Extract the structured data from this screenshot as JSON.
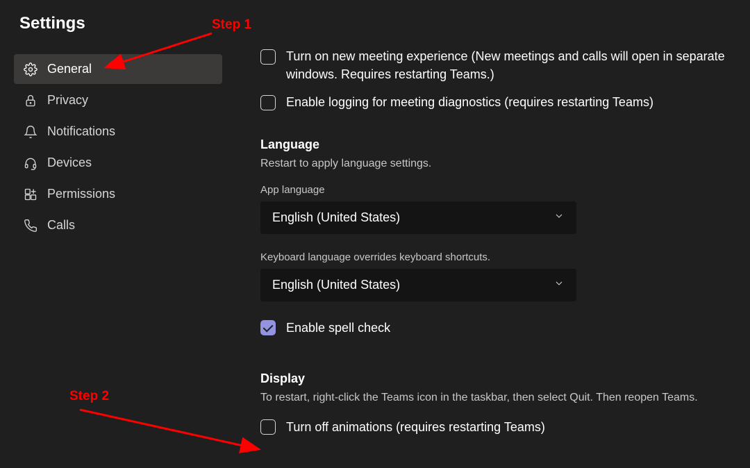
{
  "page_title": "Settings",
  "sidebar": {
    "items": [
      {
        "label": "General",
        "active": true
      },
      {
        "label": "Privacy",
        "active": false
      },
      {
        "label": "Notifications",
        "active": false
      },
      {
        "label": "Devices",
        "active": false
      },
      {
        "label": "Permissions",
        "active": false
      },
      {
        "label": "Calls",
        "active": false
      }
    ]
  },
  "checkboxes": {
    "new_meeting_experience": {
      "label": "Turn on new meeting experience (New meetings and calls will open in separate windows. Requires restarting Teams.)",
      "checked": false
    },
    "enable_logging": {
      "label": "Enable logging for meeting diagnostics (requires restarting Teams)",
      "checked": false
    },
    "enable_spell_check": {
      "label": "Enable spell check",
      "checked": true
    },
    "turn_off_animations": {
      "label": "Turn off animations (requires restarting Teams)",
      "checked": false
    }
  },
  "language_section": {
    "title": "Language",
    "subtitle": "Restart to apply language settings.",
    "app_language_label": "App language",
    "app_language_value": "English (United States)",
    "keyboard_label": "Keyboard language overrides keyboard shortcuts.",
    "keyboard_value": "English (United States)"
  },
  "display_section": {
    "title": "Display",
    "subtitle": "To restart, right-click the Teams icon in the taskbar, then select Quit. Then reopen Teams."
  },
  "annotations": {
    "step1": "Step 1",
    "step2": "Step 2"
  }
}
